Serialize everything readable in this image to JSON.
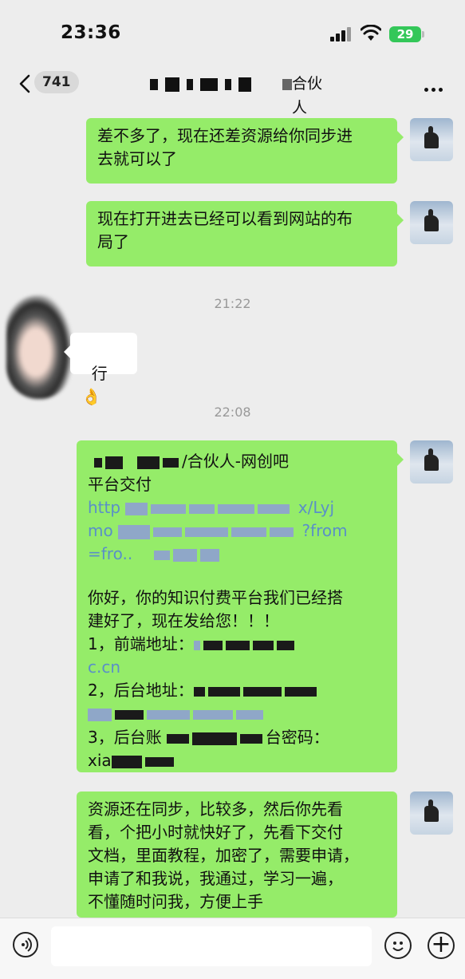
{
  "status_bar": {
    "time": "23:36",
    "battery": "29"
  },
  "nav": {
    "unread_count": "741",
    "title_visible": "合伙人"
  },
  "messages": {
    "m1": "差不多了，现在还差资源给你同步进\n去就可以了",
    "m2": "现在打开进去已经可以看到网站的布\n局了",
    "ts1": "21:22",
    "m3": "行",
    "m3_emoji": "👌",
    "ts2": "22:08",
    "m4_line1_end": "/合伙人-网创吧",
    "m4_line2": "平台交付",
    "m4_link_a": "http",
    "m4_link_b": "x/Lyj",
    "m4_link_c": "mo",
    "m4_link_d": "?from",
    "m4_link_e": "=fro..",
    "m4_body": "你好，你的知识付费平台我们已经搭\n建好了，现在发给您！！！",
    "m4_item1": "1，前端地址：",
    "m4_item1_end": "c.cn",
    "m4_item2": "2，后台地址：",
    "m4_item3": "3，后台账",
    "m4_item3_end": "台密码：",
    "m4_item3_tail": "xia",
    "m5": "资源还在同步，比较多，然后你先看\n看，个把小时就快好了，先看下交付\n文档，里面教程，加密了，需要申请，\n申请了和我说，我通过，学习一遍，\n不懂随时问我，方便上手"
  },
  "icons": {
    "back": "chevron-left-icon",
    "more": "more-icon",
    "voice": "voice-icon",
    "emoji": "emoji-icon",
    "plus": "plus-icon"
  }
}
